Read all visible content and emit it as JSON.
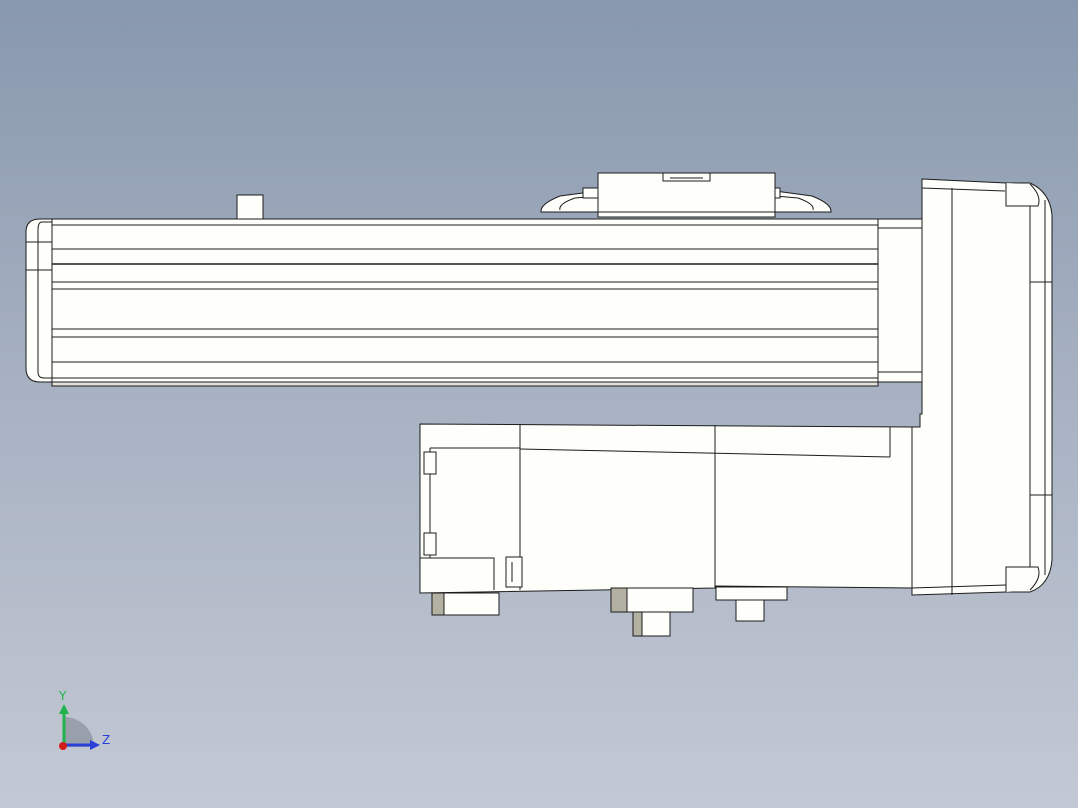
{
  "viewport": {
    "background_top": "#8898ad",
    "background_bottom": "#c3c9d4",
    "model_fill": "#fefefa",
    "model_edge": "#1c1c1c",
    "shadow_fill": "#dcdbd2",
    "connector_shade": "#b3b1a2"
  },
  "triad": {
    "y_label": "Y",
    "z_label": "Z",
    "y_color": "#1fb44a",
    "z_color": "#2a3fd6",
    "x_color": "#d21c1c",
    "y_icon": "y-axis-arrow-icon",
    "z_icon": "z-axis-arrow-icon",
    "x_icon": "x-axis-dot-icon"
  }
}
